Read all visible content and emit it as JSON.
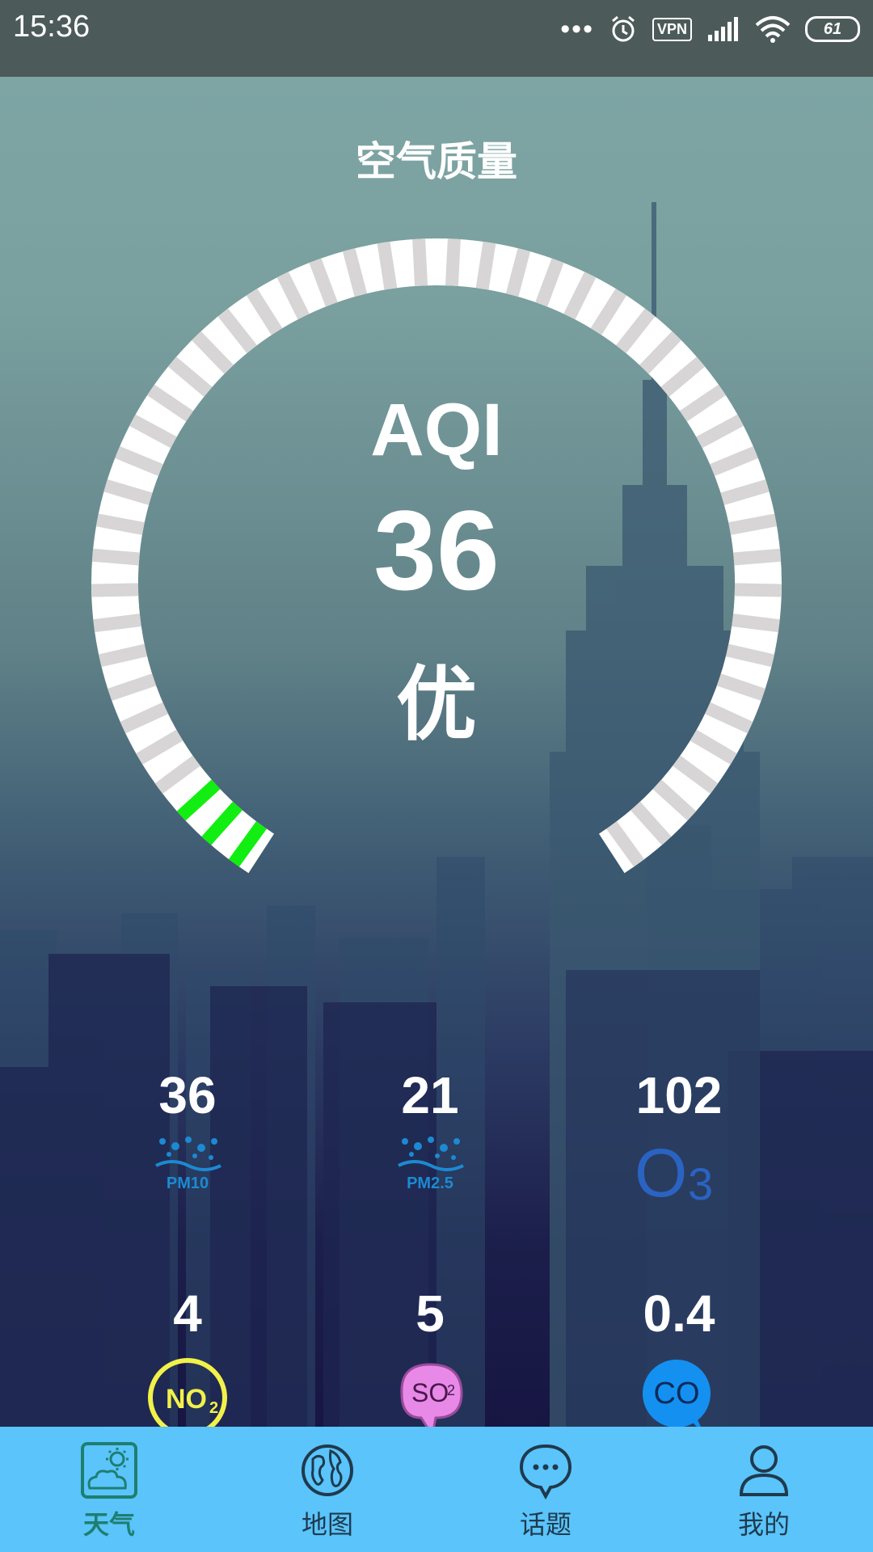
{
  "status_bar": {
    "time": "15:36",
    "vpn": "VPN",
    "battery": "61",
    "icons": [
      "more-dots-icon",
      "alarm-icon",
      "vpn-icon",
      "signal-icon",
      "wifi-icon",
      "battery-icon"
    ]
  },
  "header": {
    "title": "空气质量"
  },
  "gauge": {
    "label": "AQI",
    "value": "36",
    "level": "优",
    "fraction": 0.05,
    "active_color": "#12ee12",
    "track_color": "#ffffff",
    "segment_color": "#d7d5d5"
  },
  "pollutants": [
    {
      "value": "36",
      "name": "PM10",
      "icon": "pm10-icon"
    },
    {
      "value": "21",
      "name": "PM2.5",
      "icon": "pm25-icon"
    },
    {
      "value": "102",
      "name": "O3",
      "icon": "o3-icon"
    },
    {
      "value": "4",
      "name": "NO2",
      "icon": "no2-icon"
    },
    {
      "value": "5",
      "name": "SO2",
      "icon": "so2-icon"
    },
    {
      "value": "0.4",
      "name": "CO",
      "icon": "co-icon"
    }
  ],
  "bottom_nav": {
    "active": "天气",
    "items": [
      {
        "label": "天气",
        "icon": "weather-icon"
      },
      {
        "label": "地图",
        "icon": "globe-icon"
      },
      {
        "label": "话题",
        "icon": "chat-bubble-icon"
      },
      {
        "label": "我的",
        "icon": "person-icon"
      }
    ]
  },
  "colors": {
    "status_bar": "#4d5a5a",
    "nav_bg": "#5ac4fb",
    "nav_active": "#1e7f70",
    "pm_blue": "#1c8ad2",
    "o3_blue": "#2a63c2",
    "no2_yellow": "#f1f14a",
    "so2_pink": "#e889e8",
    "co_blue": "#1490f0"
  }
}
